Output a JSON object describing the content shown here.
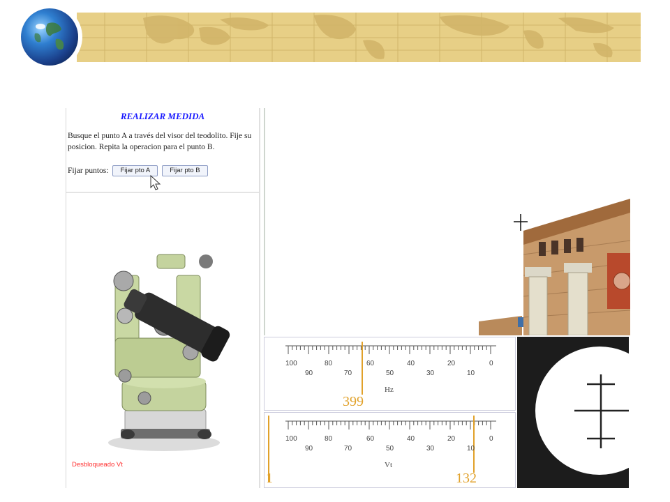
{
  "panel": {
    "title": "REALIZAR MEDIDA",
    "instructions": "Busque el punto A a través del visor del teodolito. Fije su posicion. Repita la operacion para el punto B.",
    "fix_label": "Fijar puntos:",
    "button_a": "Fijar pto A",
    "button_b": "Fijar pto B",
    "unlock_text": "Desbloqueado Vt"
  },
  "scale_hz": {
    "ticks": [
      "100",
      "90",
      "80",
      "70",
      "60",
      "50",
      "40",
      "30",
      "20",
      "10",
      "0"
    ],
    "label": "Hz",
    "reading": "399"
  },
  "scale_vt": {
    "ticks": [
      "100",
      "90",
      "80",
      "70",
      "60",
      "50",
      "40",
      "30",
      "20",
      "10",
      "0"
    ],
    "label": "Vt",
    "reading_left": "1",
    "reading_right": "132"
  },
  "colors": {
    "title_blue": "#1a1aff",
    "reading_orange": "#e1a12a",
    "unlock_red": "#ff3030",
    "banner_tan": "#e7cf86"
  }
}
